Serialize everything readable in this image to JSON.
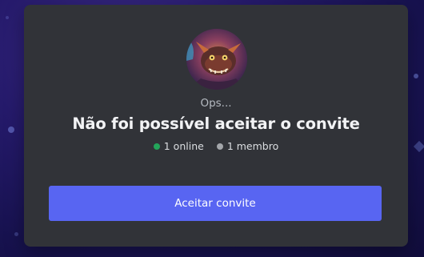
{
  "invite": {
    "eyebrow": "Ops...",
    "title": "Não foi possível aceitar o convite",
    "online_count": "1 online",
    "member_count": "1 membro",
    "accept_label": "Aceitar convite"
  },
  "colors": {
    "modal_bg": "#313338",
    "accent": "#5865f2",
    "online": "#23a55a",
    "members": "#a3a6aa"
  },
  "icons": {
    "avatar": "server-avatar-icon",
    "online_dot": "online-status-icon",
    "members_dot": "member-status-icon"
  }
}
